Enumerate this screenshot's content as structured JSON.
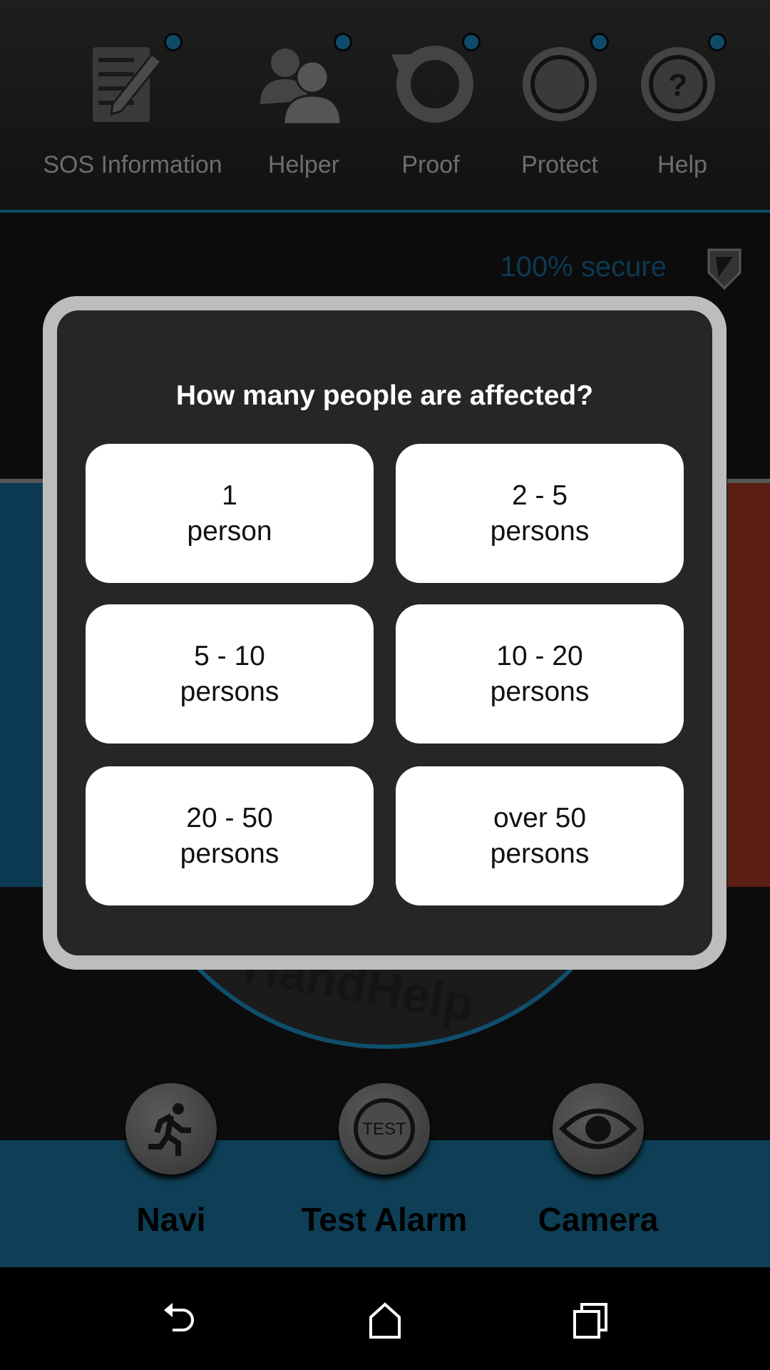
{
  "top_nav": [
    {
      "label": "SOS Information",
      "icon": "notepad-pencil-icon"
    },
    {
      "label": "Helper",
      "icon": "people-icon"
    },
    {
      "label": "Proof",
      "icon": "history-icon"
    },
    {
      "label": "Protect",
      "icon": "circle-button-icon"
    },
    {
      "label": "Help",
      "icon": "question-icon"
    }
  ],
  "status": {
    "secure_text": "100% secure",
    "icon": "shield-icon"
  },
  "logo_text": "HandHelp",
  "dialog": {
    "title": "How many people are affected?",
    "options": [
      {
        "line1": "1",
        "line2": "person"
      },
      {
        "line1": "2 - 5",
        "line2": "persons"
      },
      {
        "line1": "5 - 10",
        "line2": "persons"
      },
      {
        "line1": "10 - 20",
        "line2": "persons"
      },
      {
        "line1": "20 - 50",
        "line2": "persons"
      },
      {
        "line1": "over 50",
        "line2": "persons"
      }
    ]
  },
  "bottom_actions": [
    {
      "label": "Navi",
      "icon": "running-man-icon"
    },
    {
      "label": "Test Alarm",
      "icon": "test-button-icon",
      "icon_text": "TEST"
    },
    {
      "label": "Camera",
      "icon": "eye-icon"
    }
  ],
  "colors": {
    "accent": "#0f4e6d",
    "band": "#0e3f56",
    "dialog_bg": "#262626",
    "dialog_border": "#bdbdbd"
  }
}
